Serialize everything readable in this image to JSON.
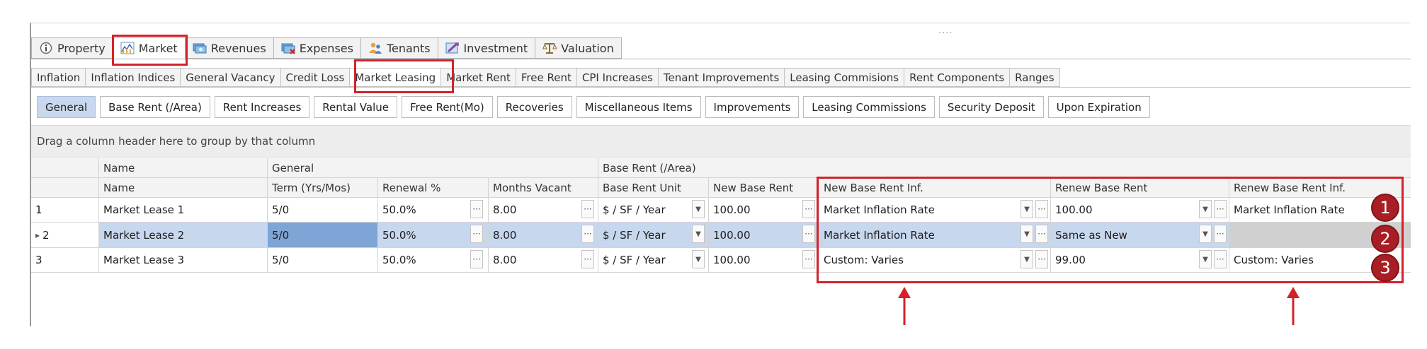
{
  "top_tabs": [
    {
      "label": "Property",
      "icon": "info-icon"
    },
    {
      "label": "Market",
      "icon": "chart-icon"
    },
    {
      "label": "Revenues",
      "icon": "money-icon"
    },
    {
      "label": "Expenses",
      "icon": "expenses-icon"
    },
    {
      "label": "Tenants",
      "icon": "tenants-icon"
    },
    {
      "label": "Investment",
      "icon": "investment-icon"
    },
    {
      "label": "Valuation",
      "icon": "valuation-icon"
    }
  ],
  "sub_tabs": [
    "Inflation",
    "Inflation Indices",
    "General Vacancy",
    "Credit Loss",
    "Market Leasing",
    "Market Rent",
    "Free Rent",
    "CPI Increases",
    "Tenant Improvements",
    "Leasing Commisions",
    "Rent Components",
    "Ranges"
  ],
  "buttons": [
    "General",
    "Base Rent (/Area)",
    "Rent Increases",
    "Rental Value",
    "Free Rent(Mo)",
    "Recoveries",
    "Miscellaneous Items",
    "Improvements",
    "Leasing Commissions",
    "Security Deposit",
    "Upon Expiration"
  ],
  "group_hint": "Drag a column header here to group by that column",
  "band_headers": {
    "name": "Name",
    "general": "General",
    "base_rent": "Base Rent (/Area)"
  },
  "columns": [
    "Name",
    "Term (Yrs/Mos)",
    "Renewal %",
    "Months Vacant",
    "Base Rent Unit",
    "New Base Rent",
    "New Base Rent Inf.",
    "Renew Base Rent",
    "Renew Base Rent Inf."
  ],
  "rows": [
    {
      "index": "1",
      "name": "Market Lease 1",
      "term": "5/0",
      "renewal": "50.0%",
      "vacant": "8.00",
      "unit": "$ / SF / Year",
      "new_rent": "100.00",
      "new_inf": "Market Inflation Rate",
      "renew_rent": "100.00",
      "renew_inf": "Market Inflation Rate"
    },
    {
      "index": "2",
      "name": "Market Lease 2",
      "term": "5/0",
      "renewal": "50.0%",
      "vacant": "8.00",
      "unit": "$ / SF / Year",
      "new_rent": "100.00",
      "new_inf": "Market Inflation Rate",
      "renew_rent": "Same as New",
      "renew_inf": ""
    },
    {
      "index": "3",
      "name": "Market Lease 3",
      "term": "5/0",
      "renewal": "50.0%",
      "vacant": "8.00",
      "unit": "$ / SF / Year",
      "new_rent": "100.00",
      "new_inf": "Custom: Varies",
      "renew_rent": "99.00",
      "renew_inf": "Custom: Varies"
    }
  ],
  "badges": [
    "1",
    "2",
    "3"
  ],
  "grip": "....",
  "ellipsis": "···",
  "dropdown": "▼",
  "row_pointer": "▸",
  "colors": {
    "annotation_red": "#d2232a",
    "selected_row": "#c7d7ee",
    "active_button": "#c9d8ee",
    "badge": "#a81e24"
  }
}
